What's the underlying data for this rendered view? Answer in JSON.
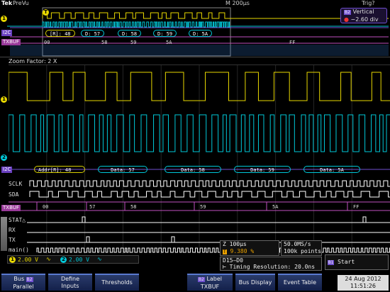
{
  "topbar": {
    "brand": "Tek",
    "mode": "PreVu",
    "timebase": "M 200µs",
    "trigger": "Trig?"
  },
  "prevu": {
    "vertical_label": "Vertical",
    "vertical_value": "−2.60 div",
    "ch1_marker": "1",
    "i2c_tag": "I2C",
    "txbuf_tag": "TXBUF",
    "i2c_packets": [
      "[R]: 48",
      "D: 57",
      "D: 58",
      "D: 59",
      "D: 5A"
    ],
    "txbuf_values": [
      "00",
      "58",
      "59",
      "5A",
      "FF"
    ]
  },
  "zoom": {
    "label": "Zoom Factor: 2 X",
    "ch1_marker": "1",
    "ch2_marker": "2",
    "b1_tag": "I2C",
    "b1_packets": [
      "Addr[R]: 48",
      "Data: 57",
      "Data: 58",
      "Data: 59",
      "Data: 5A"
    ],
    "scl_label": "SCLK",
    "sda_label": "SDA",
    "b2_tag": "TXBUF",
    "b2_values": [
      "00",
      "57",
      "58",
      "59",
      "5A",
      "FF"
    ],
    "stat_label": "STAT△",
    "rx_label": "RX",
    "tx_label": "TX",
    "main_label": "main()"
  },
  "status": {
    "ch1_scale": "2.00 V",
    "ch2_scale": "2.00 V",
    "zoom_time": "Z 100µs",
    "zoom_pos": "9.380 %",
    "sample_rate": "50.0MS/s",
    "record_length": "100k points",
    "bus_range": "D15–D0",
    "timing_res": "Timing Resolution: 20.0ns",
    "trigger_mode": "Start",
    "date": "24 Aug 2012",
    "time": "11:51:26"
  },
  "buttons": {
    "bus": "Bus",
    "bus_sub": "Parallel",
    "define": "Define",
    "inputs": "Inputs",
    "thresholds": "Thresholds",
    "label": "Label",
    "label_sub": "TXBUF",
    "bus_display": "Bus Display",
    "event_table": "Event Table"
  },
  "colors": {
    "ch1": "#e8d800",
    "ch2": "#00c8d8",
    "bus1": "#9060ff",
    "bus2": "#c050c0",
    "digital": "#ffffff"
  }
}
